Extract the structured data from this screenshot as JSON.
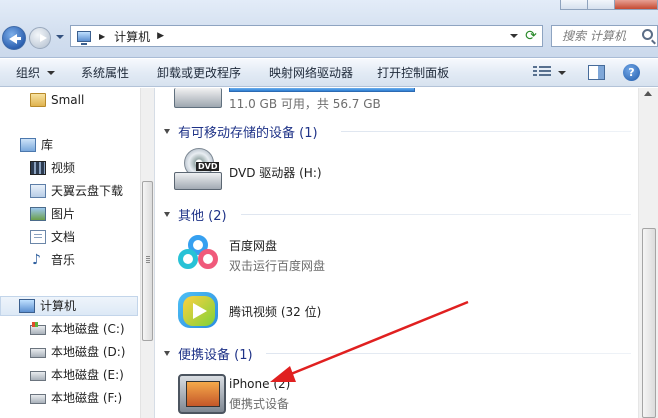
{
  "address": {
    "location": "计算机",
    "search_placeholder": "搜索 计算机"
  },
  "toolbar": {
    "organize": "组织",
    "system_properties": "系统属性",
    "uninstall": "卸载或更改程序",
    "map_drive": "映射网络驱动器",
    "control_panel": "打开控制面板"
  },
  "navpane": {
    "items": [
      {
        "label": "Small"
      },
      {
        "label": "库"
      },
      {
        "label": "视频"
      },
      {
        "label": "天翼云盘下载"
      },
      {
        "label": "图片"
      },
      {
        "label": "文档"
      },
      {
        "label": "音乐"
      },
      {
        "label": "计算机"
      },
      {
        "label": "本地磁盘 (C:)"
      },
      {
        "label": "本地磁盘 (D:)"
      },
      {
        "label": "本地磁盘 (E:)"
      },
      {
        "label": "本地磁盘 (F:)"
      }
    ]
  },
  "content": {
    "hdd_info": "11.0 GB 可用，共 56.7 GB",
    "group_removable": "有可移动存储的设备 (1)",
    "dvd_name": "DVD 驱动器 (H:)",
    "group_other": "其他 (2)",
    "baidu_name": "百度网盘",
    "baidu_sub": "双击运行百度网盘",
    "tencent_name": "腾讯视频 (32 位)",
    "group_portable": "便携设备 (1)",
    "iphone_name": "iPhone (2)",
    "iphone_sub": "便携式设备"
  },
  "colors": {
    "group_header": "#1e3287",
    "annotation_arrow": "#e02020",
    "toolbar_bg": "#dfe8f4"
  }
}
